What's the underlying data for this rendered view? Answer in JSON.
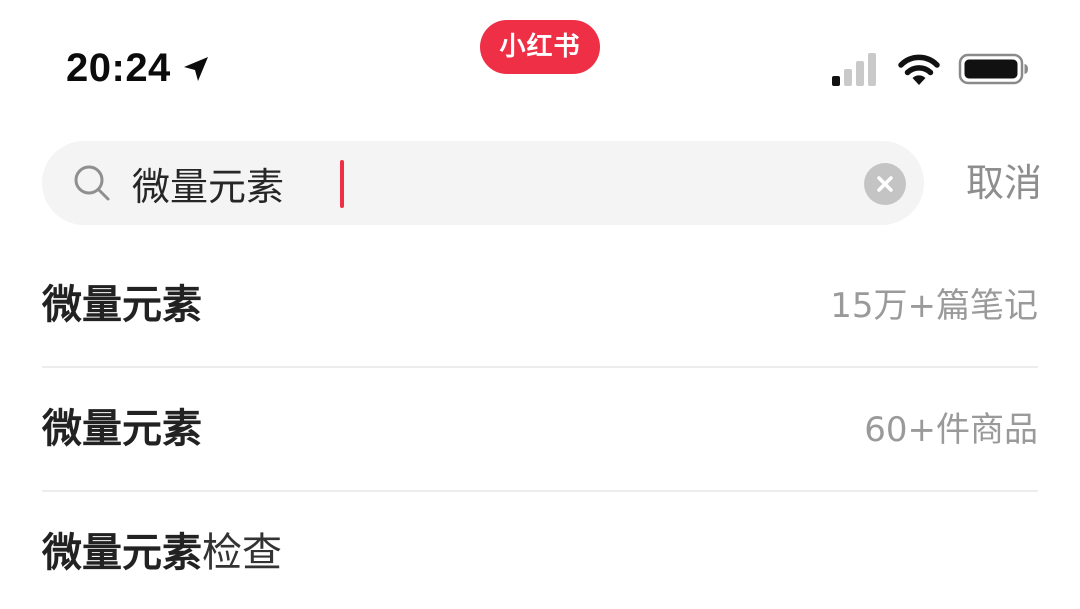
{
  "status_bar": {
    "time": "20:24",
    "app_badge": "小红书",
    "icons": [
      "location-arrow-icon",
      "cellular-signal-icon",
      "wifi-icon",
      "battery-icon"
    ]
  },
  "search": {
    "query": "微量元素",
    "icons": [
      "search-icon",
      "clear-icon"
    ],
    "cancel_label": "取消",
    "accent_color": "#ee2f45"
  },
  "suggestions": [
    {
      "highlight": "微量元素",
      "rest": "",
      "meta": "15万+篇笔记"
    },
    {
      "highlight": "微量元素",
      "rest": "",
      "meta": "60+件商品"
    },
    {
      "highlight": "微量元素",
      "rest": "检查",
      "meta": ""
    }
  ]
}
